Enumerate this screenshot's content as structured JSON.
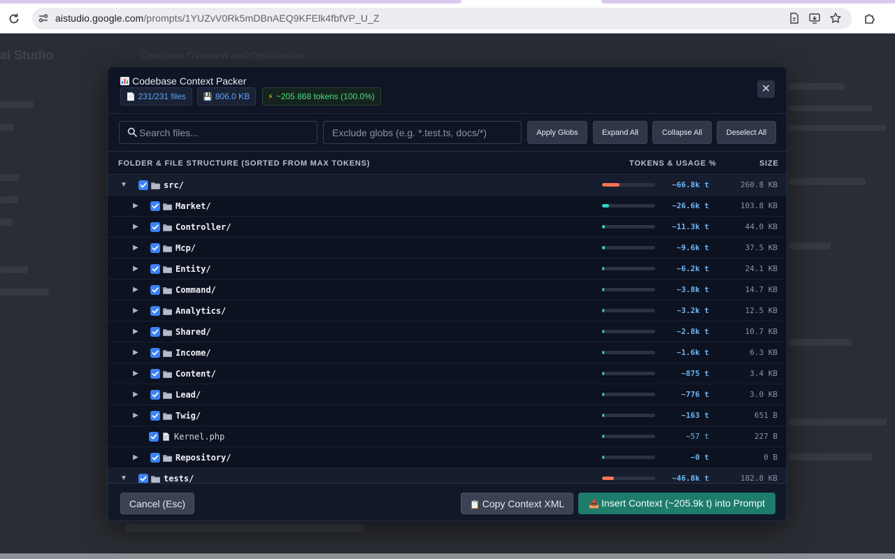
{
  "browser": {
    "url_host": "aistudio.google.com",
    "url_path": "/prompts/1YUZvV0Rk5mDBnAEQ9KFElk4fbfVP_U_Z"
  },
  "backdrop": {
    "app_title": "ai Studio",
    "prompt_title": "Codebase Overview and Optimization"
  },
  "modal": {
    "title": "Codebase Context Packer",
    "title_icon": "bar-chart-icon",
    "badges": {
      "files": "231/231 files",
      "size": "806.0 KB",
      "tokens": "~205 868 tokens (100.0%)"
    },
    "close_label": "✕",
    "search_placeholder": "Search files...",
    "globs_placeholder": "Exclude globs (e.g. *.test.ts, docs/*)",
    "buttons": {
      "apply_globs": "Apply Globs",
      "expand_all": "Expand All",
      "collapse_all": "Collapse All",
      "deselect_all": "Deselect All"
    },
    "columns": {
      "structure": "FOLDER & FILE STRUCTURE (SORTED FROM MAX TOKENS)",
      "tokens": "TOKENS & USAGE %",
      "size": "SIZE"
    },
    "rows": [
      {
        "name": "src/",
        "type": "folder",
        "level": 0,
        "expanded": true,
        "checked": true,
        "tokens": "~66.8k t",
        "size": "260.8 KB",
        "usage": 0.324,
        "bar_color": "#f97352"
      },
      {
        "name": "Market/",
        "type": "folder",
        "level": 1,
        "expanded": false,
        "checked": true,
        "tokens": "~26.6k t",
        "size": "103.8 KB",
        "usage": 0.129,
        "bar_color": "#2dd4bf"
      },
      {
        "name": "Controller/",
        "type": "folder",
        "level": 1,
        "expanded": false,
        "checked": true,
        "tokens": "~11.3k t",
        "size": "44.0 KB",
        "usage": 0.055,
        "bar_color": "#2dd4bf"
      },
      {
        "name": "Mcp/",
        "type": "folder",
        "level": 1,
        "expanded": false,
        "checked": true,
        "tokens": "~9.6k t",
        "size": "37.5 KB",
        "usage": 0.047,
        "bar_color": "#2dd4bf"
      },
      {
        "name": "Entity/",
        "type": "folder",
        "level": 1,
        "expanded": false,
        "checked": true,
        "tokens": "~6.2k t",
        "size": "24.1 KB",
        "usage": 0.03,
        "bar_color": "#2dd4bf"
      },
      {
        "name": "Command/",
        "type": "folder",
        "level": 1,
        "expanded": false,
        "checked": true,
        "tokens": "~3.8k t",
        "size": "14.7 KB",
        "usage": 0.018,
        "bar_color": "#2dd4bf"
      },
      {
        "name": "Analytics/",
        "type": "folder",
        "level": 1,
        "expanded": false,
        "checked": true,
        "tokens": "~3.2k t",
        "size": "12.5 KB",
        "usage": 0.016,
        "bar_color": "#2dd4bf"
      },
      {
        "name": "Shared/",
        "type": "folder",
        "level": 1,
        "expanded": false,
        "checked": true,
        "tokens": "~2.8k t",
        "size": "10.7 KB",
        "usage": 0.014,
        "bar_color": "#2dd4bf"
      },
      {
        "name": "Income/",
        "type": "folder",
        "level": 1,
        "expanded": false,
        "checked": true,
        "tokens": "~1.6k t",
        "size": "6.3 KB",
        "usage": 0.008,
        "bar_color": "#2dd4bf"
      },
      {
        "name": "Content/",
        "type": "folder",
        "level": 1,
        "expanded": false,
        "checked": true,
        "tokens": "~875 t",
        "size": "3.4 KB",
        "usage": 0.004,
        "bar_color": "#2dd4bf"
      },
      {
        "name": "Lead/",
        "type": "folder",
        "level": 1,
        "expanded": false,
        "checked": true,
        "tokens": "~776 t",
        "size": "3.0 KB",
        "usage": 0.004,
        "bar_color": "#2dd4bf"
      },
      {
        "name": "Twig/",
        "type": "folder",
        "level": 1,
        "expanded": false,
        "checked": true,
        "tokens": "~163 t",
        "size": "651 B",
        "usage": 0.001,
        "bar_color": "#2dd4bf"
      },
      {
        "name": "Kernel.php",
        "type": "file",
        "level": 1,
        "expanded": false,
        "checked": true,
        "tokens": "~57 t",
        "size": "227 B",
        "usage": 0.0003,
        "bar_color": "#2dd4bf"
      },
      {
        "name": "Repository/",
        "type": "folder",
        "level": 1,
        "expanded": false,
        "checked": true,
        "tokens": "~0 t",
        "size": "0 B",
        "usage": 0.0,
        "bar_color": "#2dd4bf"
      },
      {
        "name": "tests/",
        "type": "folder",
        "level": 0,
        "expanded": true,
        "checked": true,
        "tokens": "~46.8k t",
        "size": "182.8 KB",
        "usage": 0.227,
        "bar_color": "#f97352"
      }
    ],
    "footer": {
      "cancel": "Cancel (Esc)",
      "copy": "Copy Context XML",
      "insert": "Insert Context (~205.9k t) into Prompt"
    }
  }
}
